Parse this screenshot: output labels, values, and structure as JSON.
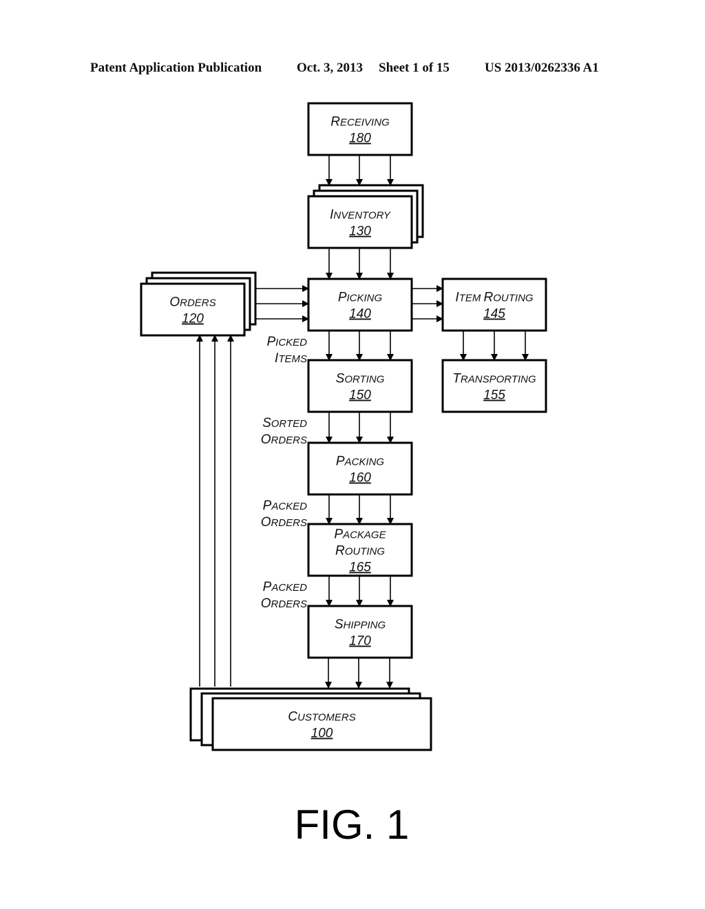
{
  "header": {
    "publication": "Patent Application Publication",
    "date": "Oct. 3, 2013",
    "sheet": "Sheet 1 of 15",
    "number": "US 2013/0262336 A1"
  },
  "figure_label": "FIG. 1",
  "nodes": {
    "receiving": {
      "label": [
        "Receiving"
      ],
      "ref": "180",
      "stacked": false
    },
    "inventory": {
      "label": [
        "Inventory"
      ],
      "ref": "130",
      "stacked": true
    },
    "orders": {
      "label": [
        "Orders"
      ],
      "ref": "120",
      "stacked": true
    },
    "picking": {
      "label": [
        "Picking"
      ],
      "ref": "140",
      "stacked": false
    },
    "item_routing": {
      "label": [
        "Item Routing"
      ],
      "ref": "145",
      "stacked": false
    },
    "transporting": {
      "label": [
        "Transporting"
      ],
      "ref": "155",
      "stacked": false
    },
    "sorting": {
      "label": [
        "Sorting"
      ],
      "ref": "150",
      "stacked": false
    },
    "packing": {
      "label": [
        "Packing"
      ],
      "ref": "160",
      "stacked": false
    },
    "package_routing": {
      "label": [
        "Package",
        "Routing"
      ],
      "ref": "165",
      "stacked": false
    },
    "shipping": {
      "label": [
        "Shipping"
      ],
      "ref": "170",
      "stacked": false
    },
    "customers": {
      "label": [
        "Customers"
      ],
      "ref": "100",
      "stacked": true
    }
  },
  "edges": [
    {
      "from": "receiving",
      "to": "inventory",
      "count": 3,
      "label": []
    },
    {
      "from": "inventory",
      "to": "picking",
      "count": 3,
      "label": []
    },
    {
      "from": "orders",
      "to": "picking",
      "count": 3,
      "label": []
    },
    {
      "from": "picking",
      "to": "item_routing",
      "count": 3,
      "label": []
    },
    {
      "from": "item_routing",
      "to": "transporting",
      "count": 3,
      "label": []
    },
    {
      "from": "picking",
      "to": "sorting",
      "count": 3,
      "label": [
        "Picked",
        "Items"
      ]
    },
    {
      "from": "sorting",
      "to": "packing",
      "count": 3,
      "label": [
        "Sorted",
        "Orders"
      ]
    },
    {
      "from": "packing",
      "to": "package_routing",
      "count": 3,
      "label": [
        "Packed",
        "Orders"
      ]
    },
    {
      "from": "package_routing",
      "to": "shipping",
      "count": 3,
      "label": [
        "Packed",
        "Orders"
      ]
    },
    {
      "from": "shipping",
      "to": "customers",
      "count": 3,
      "label": []
    },
    {
      "from": "customers",
      "to": "orders",
      "count": 3,
      "label": []
    }
  ]
}
